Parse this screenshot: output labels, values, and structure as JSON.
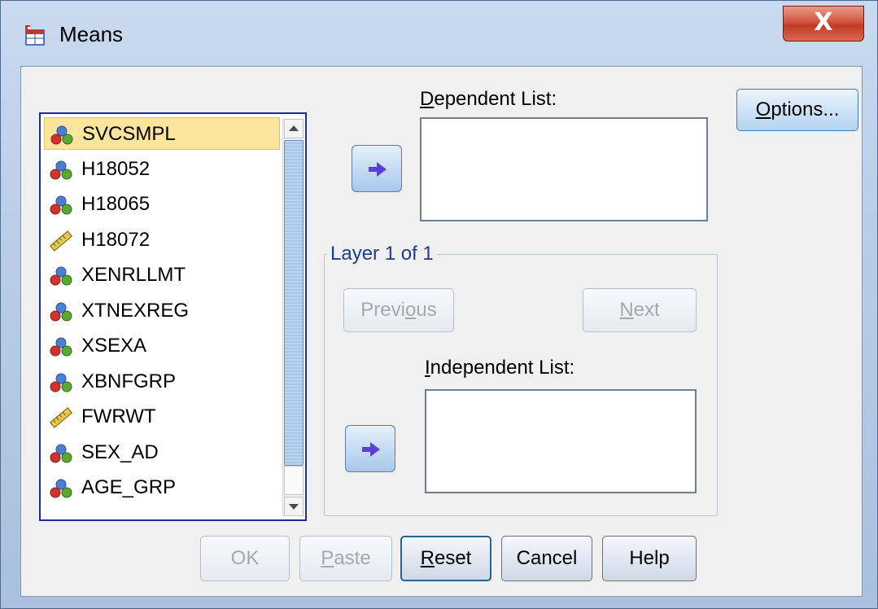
{
  "window": {
    "title": "Means",
    "close_label": "X"
  },
  "variables": [
    {
      "name": "SVCSMPL",
      "type": "nominal",
      "selected": true
    },
    {
      "name": "H18052",
      "type": "nominal"
    },
    {
      "name": "H18065",
      "type": "nominal"
    },
    {
      "name": "H18072",
      "type": "scale"
    },
    {
      "name": "XENRLLMT",
      "type": "nominal"
    },
    {
      "name": "XTNEXREG",
      "type": "nominal"
    },
    {
      "name": "XSEXA",
      "type": "nominal"
    },
    {
      "name": "XBNFGRP",
      "type": "nominal"
    },
    {
      "name": "FWRWT",
      "type": "scale"
    },
    {
      "name": "SEX_AD",
      "type": "nominal"
    },
    {
      "name": "AGE_GRP",
      "type": "nominal"
    }
  ],
  "dependent": {
    "label_first": "D",
    "label_rest": "ependent List:"
  },
  "layer": {
    "label": "Layer 1 of 1",
    "previous_a": "Previ",
    "previous_u": "o",
    "previous_b": "us",
    "next_u": "N",
    "next_rest": "ext"
  },
  "independent": {
    "label_first": "I",
    "label_rest": "ndependent List:"
  },
  "buttons": {
    "options_u": "O",
    "options_rest": "ptions...",
    "ok": "OK",
    "paste_u": "P",
    "paste_rest": "aste",
    "reset_u": "R",
    "reset_rest": "eset",
    "cancel": "Cancel",
    "help": "Help"
  },
  "colors": {
    "selected_row": "#fde59e",
    "list_border": "#1e2b9a",
    "group_label": "#1f3c8a",
    "close_button": "#c23a24"
  },
  "icons": {
    "nominal": "nominal-measure-icon",
    "scale": "scale-measure-icon",
    "arrow": "move-right-arrow-icon"
  }
}
